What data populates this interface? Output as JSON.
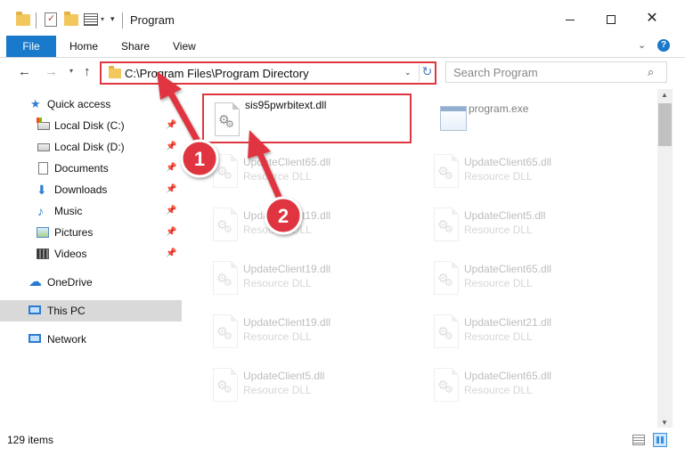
{
  "window": {
    "title": "Program",
    "minimize_glyph": "—",
    "maximize_glyph": "☐",
    "close_glyph": "✕"
  },
  "ribbon": {
    "tabs": [
      {
        "label": "File"
      },
      {
        "label": "Home"
      },
      {
        "label": "Share"
      },
      {
        "label": "View"
      }
    ],
    "collapse_glyph": "⌄",
    "help_glyph": "?"
  },
  "nav": {
    "back_glyph": "←",
    "forward_glyph": "→",
    "up_glyph": "↑",
    "address": "C:\\Program Files\\Program Directory",
    "search_placeholder": "Search Program"
  },
  "pane": {
    "items": [
      {
        "label": "Quick access",
        "icon": "star-icon"
      },
      {
        "label": "Local Disk (C:)",
        "icon": "drive-icon",
        "pinned": true
      },
      {
        "label": "Local Disk (D:)",
        "icon": "drive-icon",
        "pinned": true
      },
      {
        "label": "Documents",
        "icon": "documents-icon",
        "pinned": true
      },
      {
        "label": "Downloads",
        "icon": "download-icon",
        "pinned": true
      },
      {
        "label": "Music",
        "icon": "music-icon",
        "pinned": true
      },
      {
        "label": "Pictures",
        "icon": "pictures-icon",
        "pinned": true
      },
      {
        "label": "Videos",
        "icon": "videos-icon",
        "pinned": true
      },
      {
        "label": "OneDrive",
        "icon": "cloud-icon"
      },
      {
        "label": "This PC",
        "icon": "computer-icon"
      },
      {
        "label": "Network",
        "icon": "network-icon"
      }
    ]
  },
  "files": {
    "selected": {
      "name": "sis95pwrbitext.dll"
    },
    "exe": {
      "name": "program.exe"
    },
    "tiles": [
      {
        "name": "UpdateClient65.dll",
        "type": "Resource DLL"
      },
      {
        "name": "UpdateClient65.dll",
        "type": "Resource DLL"
      },
      {
        "name": "UpdateClient19.dll",
        "type": "Resource DLL"
      },
      {
        "name": "UpdateClient5.dll",
        "type": "Resource DLL"
      },
      {
        "name": "UpdateClient19.dll",
        "type": "Resource DLL"
      },
      {
        "name": "UpdateClient65.dll",
        "type": "Resource DLL"
      },
      {
        "name": "UpdateClient19.dll",
        "type": "Resource DLL"
      },
      {
        "name": "UpdateClient21.dll",
        "type": "Resource DLL"
      },
      {
        "name": "UpdateClient5.dll",
        "type": "Resource DLL"
      },
      {
        "name": "UpdateClient65.dll",
        "type": "Resource DLL"
      }
    ]
  },
  "status": {
    "item_count": "129 items"
  },
  "callouts": [
    {
      "number": "1"
    },
    {
      "number": "2"
    }
  ],
  "colors": {
    "accent": "#1979ca",
    "highlight_box": "#e0363f",
    "callout": "#e0363f"
  }
}
